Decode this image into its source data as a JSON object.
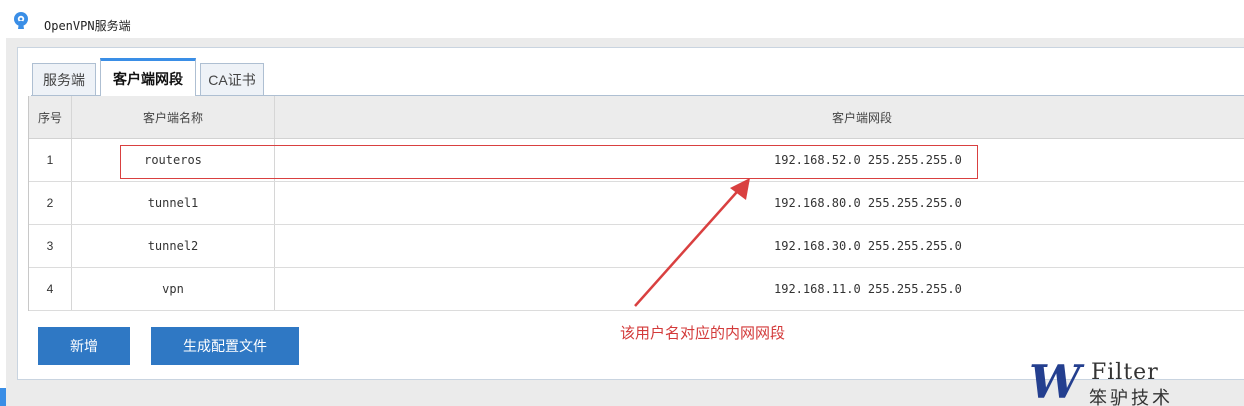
{
  "window": {
    "title": "OpenVPN服务端",
    "icon": "openvpn-icon"
  },
  "tabs": [
    {
      "label": "服务端",
      "active": false
    },
    {
      "label": "客户端网段",
      "active": true
    },
    {
      "label": "CA证书",
      "active": false
    }
  ],
  "table": {
    "headers": {
      "index": "序号",
      "name": "客户端名称",
      "subnet": "客户端网段"
    },
    "rows": [
      {
        "index": "1",
        "name": "routeros",
        "subnet": "192.168.52.0 255.255.255.0"
      },
      {
        "index": "2",
        "name": "tunnel1",
        "subnet": "192.168.80.0 255.255.255.0"
      },
      {
        "index": "3",
        "name": "tunnel2",
        "subnet": "192.168.30.0 255.255.255.0"
      },
      {
        "index": "4",
        "name": "vpn",
        "subnet": "192.168.11.0 255.255.255.0"
      }
    ]
  },
  "buttons": {
    "add": "新增",
    "generate_config": "生成配置文件"
  },
  "annotation": {
    "text": "该用户名对应的内网网段",
    "color": "#d33a3a"
  },
  "watermark": {
    "letter": "W",
    "brand": "Filter",
    "chinese": "笨驴技术"
  },
  "colors": {
    "accent": "#2f78c4",
    "tab_active": "#3a8ee6",
    "highlight": "#d94040"
  }
}
